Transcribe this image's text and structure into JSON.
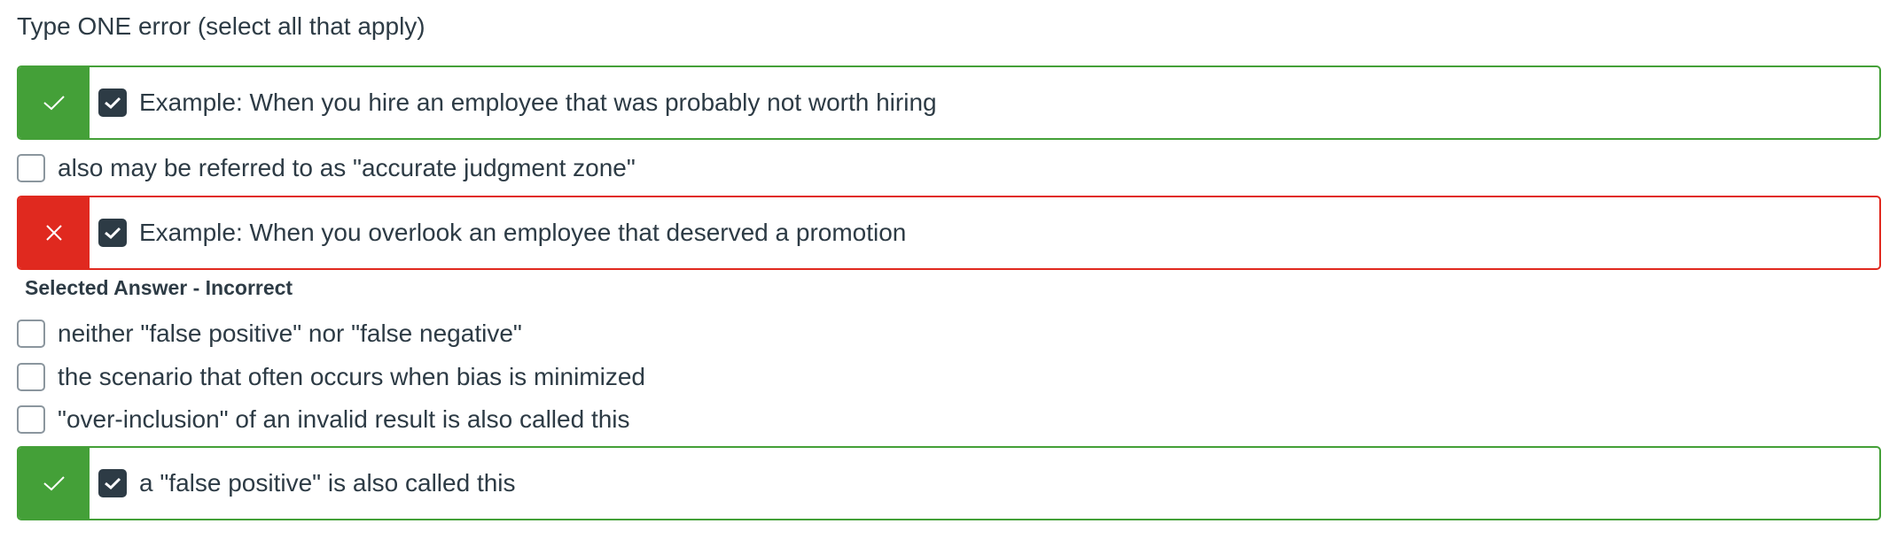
{
  "question": {
    "title": "Type ONE error (select all that apply)"
  },
  "answers": [
    {
      "text": "Example: When you hire an employee that was probably not worth hiring",
      "checked": true,
      "status": "correct",
      "status_icon": "check-icon"
    },
    {
      "text": "also may be referred to as \"accurate judgment zone\"",
      "checked": false,
      "status": "none"
    },
    {
      "text": "Example: When you overlook an employee that deserved a promotion",
      "checked": true,
      "status": "incorrect",
      "status_icon": "x-icon"
    },
    {
      "text": "neither \"false positive\" nor \"false negative\"",
      "checked": false,
      "status": "none"
    },
    {
      "text": "the scenario that often occurs when bias is minimized",
      "checked": false,
      "status": "none"
    },
    {
      "text": "\"over-inclusion\" of an invalid result is also called this",
      "checked": false,
      "status": "none"
    },
    {
      "text": "a \"false positive\" is also called this",
      "checked": true,
      "status": "correct",
      "status_icon": "check-icon"
    }
  ],
  "feedback": {
    "selected_incorrect": "Selected Answer - Incorrect"
  },
  "colors": {
    "correct": "#44a038",
    "incorrect": "#e0291f",
    "checkbox_checked": "#2d3b45",
    "text": "#2d3b45"
  }
}
